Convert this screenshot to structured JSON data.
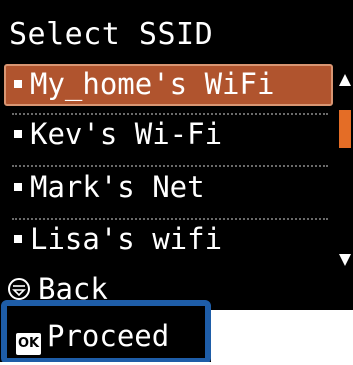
{
  "header": {
    "title": "Select SSID"
  },
  "ssid_list": {
    "items": [
      {
        "label": "My_home's WiFi",
        "selected": true
      },
      {
        "label": "Kev's Wi-Fi",
        "selected": false
      },
      {
        "label": "Mark's Net",
        "selected": false
      },
      {
        "label": "Lisa's wifi",
        "selected": false
      }
    ]
  },
  "footer": {
    "back_label": "Back",
    "back_icon": "back-button-circle-icon",
    "ok_key": "OK",
    "proceed_label": "Proceed"
  },
  "colors": {
    "screen_background": "#000000",
    "selected_row": "#b0542e",
    "scroll_thumb": "#e46d26",
    "highlight_frame": "#1e5da8",
    "text": "#ffffff"
  }
}
